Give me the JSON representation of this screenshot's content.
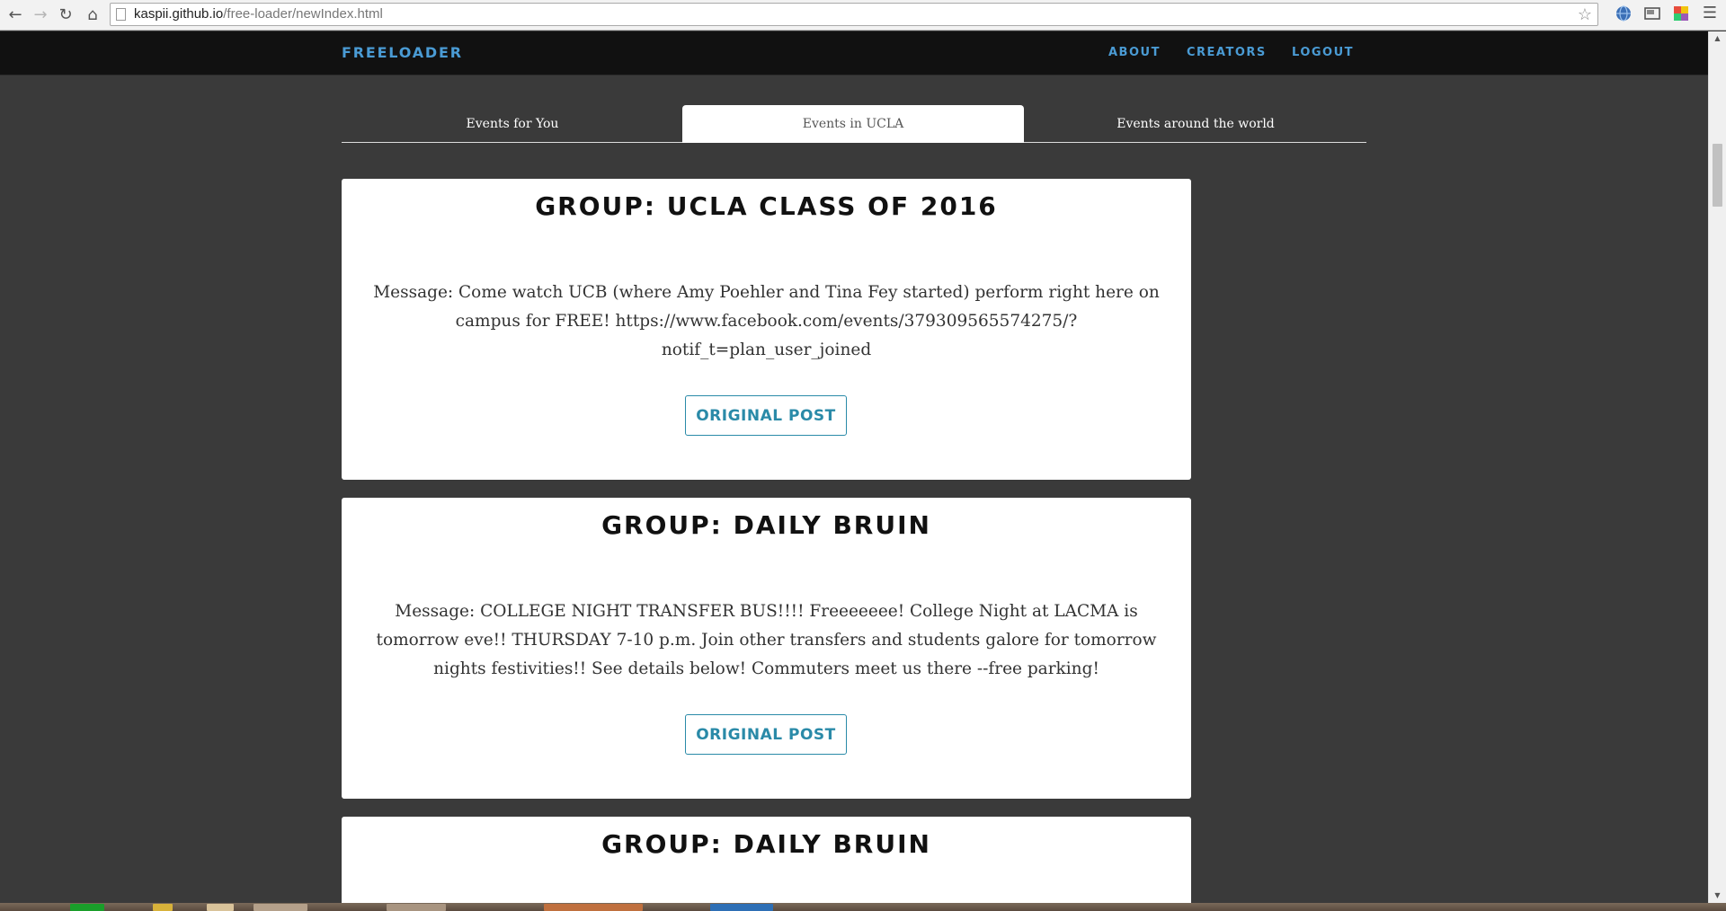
{
  "browser": {
    "url_host": "kaspii.github.io",
    "url_path": "/free-loader/newIndex.html",
    "back_icon": "arrow-left-icon",
    "forward_icon": "arrow-right-icon",
    "reload_icon": "reload-icon",
    "home_icon": "home-icon",
    "star_icon": "star-icon",
    "menu_icon": "hamburger-menu-icon"
  },
  "site": {
    "brand": "FREELOADER",
    "menu": [
      {
        "label": "ABOUT"
      },
      {
        "label": "CREATORS"
      },
      {
        "label": "LOGOUT"
      }
    ],
    "accent_color": "#4a9bd4",
    "nav_background": "#111111",
    "page_background": "#3a3a3a"
  },
  "tabs": [
    {
      "label": "Events for You",
      "active": false
    },
    {
      "label": "Events in UCLA",
      "active": true
    },
    {
      "label": "Events around the world",
      "active": false
    }
  ],
  "events": [
    {
      "group": "GROUP: UCLA CLASS OF 2016",
      "message": "Message: Come watch UCB (where Amy Poehler and Tina Fey started) perform right here on campus for FREE! https://www.facebook.com/events/379309565574275/?notif_t=plan_user_joined",
      "button": "ORIGINAL POST"
    },
    {
      "group": "GROUP: DAILY BRUIN",
      "message": "Message: COLLEGE NIGHT TRANSFER BUS!!!! Freeeeeee! College Night at LACMA is tomorrow eve!! THURSDAY 7-10 p.m. Join other transfers and students galore for tomorrow nights festivities!! See details below! Commuters meet us there --free parking!",
      "button": "ORIGINAL POST"
    },
    {
      "group": "GROUP: DAILY BRUIN"
    }
  ],
  "button_color": "#2a8aa8"
}
